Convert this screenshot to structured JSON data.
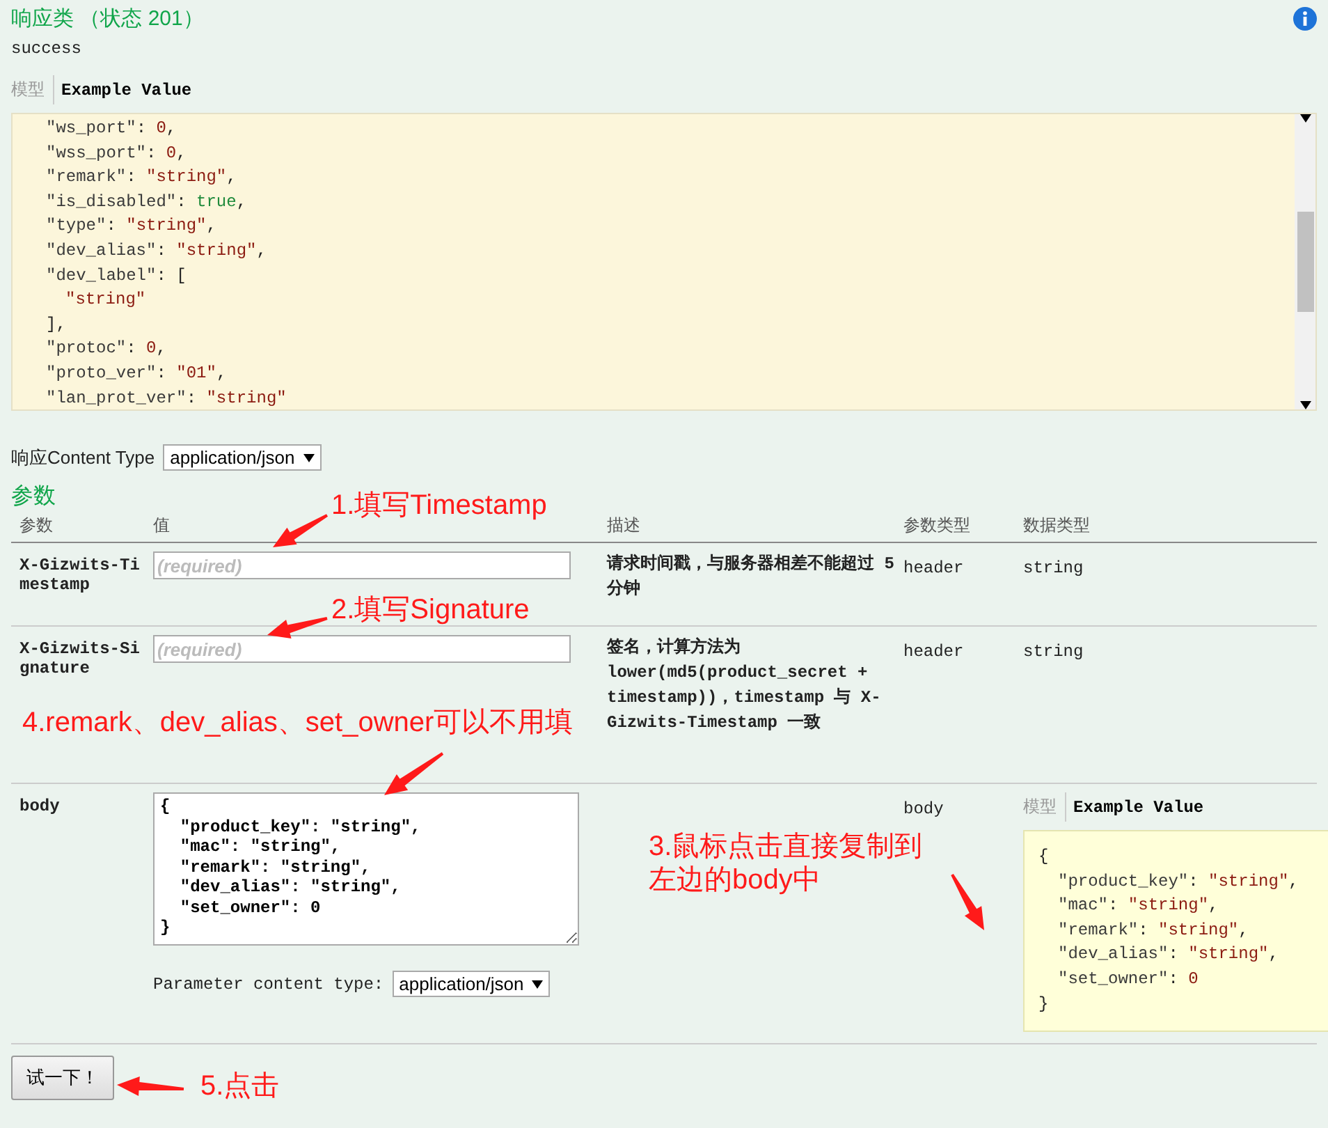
{
  "response": {
    "title": "响应类 （状态 201）",
    "description": "success",
    "tabs": [
      {
        "label": "模型",
        "selected": false
      },
      {
        "label": "Example Value",
        "selected": true
      }
    ],
    "example_lines": [
      {
        "tokens": [
          {
            "kind": "key",
            "t": "\"ws_port\""
          },
          {
            "kind": "punct",
            "t": ": "
          },
          {
            "kind": "number",
            "t": "0"
          },
          {
            "kind": "punct",
            "t": ","
          }
        ]
      },
      {
        "tokens": [
          {
            "kind": "key",
            "t": "\"wss_port\""
          },
          {
            "kind": "punct",
            "t": ": "
          },
          {
            "kind": "number",
            "t": "0"
          },
          {
            "kind": "punct",
            "t": ","
          }
        ]
      },
      {
        "tokens": [
          {
            "kind": "key",
            "t": "\"remark\""
          },
          {
            "kind": "punct",
            "t": ": "
          },
          {
            "kind": "string",
            "t": "\"string\""
          },
          {
            "kind": "punct",
            "t": ","
          }
        ]
      },
      {
        "tokens": [
          {
            "kind": "key",
            "t": "\"is_disabled\""
          },
          {
            "kind": "punct",
            "t": ": "
          },
          {
            "kind": "boolean",
            "t": "true"
          },
          {
            "kind": "punct",
            "t": ","
          }
        ]
      },
      {
        "tokens": [
          {
            "kind": "key",
            "t": "\"type\""
          },
          {
            "kind": "punct",
            "t": ": "
          },
          {
            "kind": "string",
            "t": "\"string\""
          },
          {
            "kind": "punct",
            "t": ","
          }
        ]
      },
      {
        "tokens": [
          {
            "kind": "key",
            "t": "\"dev_alias\""
          },
          {
            "kind": "punct",
            "t": ": "
          },
          {
            "kind": "string",
            "t": "\"string\""
          },
          {
            "kind": "punct",
            "t": ","
          }
        ]
      },
      {
        "tokens": [
          {
            "kind": "key",
            "t": "\"dev_label\""
          },
          {
            "kind": "punct",
            "t": ": ["
          }
        ],
        "children": [
          {
            "tokens": [
              {
                "kind": "string",
                "t": "\"string\""
              }
            ]
          }
        ]
      },
      {
        "tokens": [
          {
            "kind": "punct",
            "t": "],"
          }
        ]
      },
      {
        "tokens": [
          {
            "kind": "key",
            "t": "\"protoc\""
          },
          {
            "kind": "punct",
            "t": ": "
          },
          {
            "kind": "number",
            "t": "0"
          },
          {
            "kind": "punct",
            "t": ","
          }
        ]
      },
      {
        "tokens": [
          {
            "kind": "key",
            "t": "\"proto_ver\""
          },
          {
            "kind": "punct",
            "t": ": "
          },
          {
            "kind": "string",
            "t": "\"01\""
          },
          {
            "kind": "punct",
            "t": ","
          }
        ]
      },
      {
        "tokens": [
          {
            "kind": "key",
            "t": "\"lan_prot_ver\""
          },
          {
            "kind": "punct",
            "t": ": "
          },
          {
            "kind": "string",
            "t": "\"string\""
          }
        ]
      }
    ]
  },
  "content_type": {
    "label": "响应Content Type",
    "value": "application/json"
  },
  "parameters": {
    "title": "参数",
    "columns": [
      "参数",
      "值",
      "描述",
      "参数类型",
      "数据类型"
    ],
    "rows": [
      {
        "kind": "input",
        "name": "X-Gizwits-Timestamp",
        "placeholder": "(required)",
        "description": "请求时间戳，与服务器相差不能超过 5 分钟",
        "param_type": "header",
        "data_type": "string"
      },
      {
        "kind": "input",
        "name": "X-Gizwits-Signature",
        "placeholder": "(required)",
        "description": "签名，计算方法为 lower(md5(product_secret + timestamp))，timestamp 与 X-Gizwits-Timestamp 一致",
        "param_type": "header",
        "data_type": "string"
      },
      {
        "kind": "body",
        "name": "body",
        "value": "{\n  \"product_key\": \"string\",\n  \"mac\": \"string\",\n  \"remark\": \"string\",\n  \"dev_alias\": \"string\",\n  \"set_owner\": 0\n}",
        "content_type_label": "Parameter content type:",
        "content_type": "application/json",
        "param_type": "body",
        "tabs": [
          {
            "label": "模型",
            "selected": false
          },
          {
            "label": "Example Value",
            "selected": true
          }
        ],
        "example_lines": [
          {
            "tokens": [
              {
                "kind": "punct",
                "t": "{"
              }
            ],
            "children": [
              {
                "tokens": [
                  {
                    "kind": "key",
                    "t": "\"product_key\""
                  },
                  {
                    "kind": "punct",
                    "t": ": "
                  },
                  {
                    "kind": "string",
                    "t": "\"string\""
                  },
                  {
                    "kind": "punct",
                    "t": ","
                  }
                ]
              },
              {
                "tokens": [
                  {
                    "kind": "key",
                    "t": "\"mac\""
                  },
                  {
                    "kind": "punct",
                    "t": ": "
                  },
                  {
                    "kind": "string",
                    "t": "\"string\""
                  },
                  {
                    "kind": "punct",
                    "t": ","
                  }
                ]
              },
              {
                "tokens": [
                  {
                    "kind": "key",
                    "t": "\"remark\""
                  },
                  {
                    "kind": "punct",
                    "t": ": "
                  },
                  {
                    "kind": "string",
                    "t": "\"string\""
                  },
                  {
                    "kind": "punct",
                    "t": ","
                  }
                ]
              },
              {
                "tokens": [
                  {
                    "kind": "key",
                    "t": "\"dev_alias\""
                  },
                  {
                    "kind": "punct",
                    "t": ": "
                  },
                  {
                    "kind": "string",
                    "t": "\"string\""
                  },
                  {
                    "kind": "punct",
                    "t": ","
                  }
                ]
              },
              {
                "tokens": [
                  {
                    "kind": "key",
                    "t": "\"set_owner\""
                  },
                  {
                    "kind": "punct",
                    "t": ": "
                  },
                  {
                    "kind": "number",
                    "t": "0"
                  }
                ]
              }
            ]
          },
          {
            "tokens": [
              {
                "kind": "punct",
                "t": "}"
              }
            ]
          }
        ]
      }
    ]
  },
  "try_button": "试一下！",
  "annotations": [
    "1.填写Timestamp",
    "2.填写Signature",
    "3.鼠标点击直接复制到左边的body中",
    "4.remark、dev_alias、set_owner可以不用填",
    "5.点击"
  ]
}
